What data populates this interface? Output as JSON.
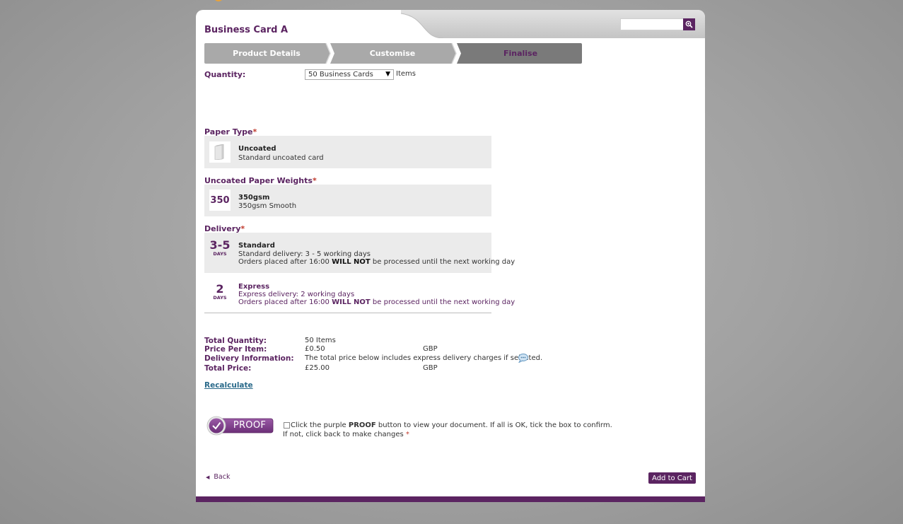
{
  "header": {
    "title": "Business Card A",
    "search": {
      "placeholder": "",
      "value": ""
    }
  },
  "steps": [
    {
      "label": "Product Details",
      "state": "done"
    },
    {
      "label": "Customise",
      "state": "done"
    },
    {
      "label": "Finalise",
      "state": "current"
    }
  ],
  "quantity": {
    "label": "Quantity:",
    "selected": "50 Business Cards",
    "unit": "Items"
  },
  "paper_type": {
    "label": "Paper Type",
    "required_mark": "*",
    "option": {
      "title": "Uncoated",
      "desc": "Standard uncoated card",
      "icon": "paper-icon"
    }
  },
  "paper_weight": {
    "label": "Uncoated Paper Weights",
    "required_mark": "*",
    "option": {
      "icon_text": "350",
      "title": "350gsm",
      "desc": "350gsm Smooth"
    }
  },
  "delivery": {
    "label": "Delivery",
    "required_mark": "*",
    "options": [
      {
        "icon_num": "3-5",
        "icon_unit": "DAYS",
        "title": "Standard",
        "desc": "Standard delivery: 3 - 5 working days",
        "note_before": "Orders placed after 16:00 ",
        "note_bold": "WILL NOT",
        "note_after": " be processed until the next working day",
        "selected": true
      },
      {
        "icon_num": "2",
        "icon_unit": "DAYS",
        "title": "Express",
        "desc": "Express delivery: 2 working days",
        "note_before": "Orders placed after 16:00 ",
        "note_bold": "WILL NOT",
        "note_after": " be processed until the next working day",
        "selected": false
      }
    ]
  },
  "summary": {
    "total_quantity_label": "Total Quantity:",
    "total_quantity_value": "50 Items",
    "price_per_item_label": "Price Per Item:",
    "price_per_item_value": "£0.50",
    "price_per_item_currency": "GBP",
    "delivery_info_label": "Delivery Information:",
    "delivery_info_value": "The total price below includes express delivery charges if selected.",
    "total_price_label": "Total Price:",
    "total_price_value": "£25.00",
    "total_price_currency": "GBP"
  },
  "recalculate_label": "Recalculate",
  "proof": {
    "button_label": "PROOF",
    "text_before": "Click the purple ",
    "text_bold": "PROOF",
    "text_after": " button to view your document. If all is OK, tick the box to confirm.",
    "text_line2": "If not, click back to make changes",
    "required_mark": "*",
    "checked": false
  },
  "footer": {
    "back_label": "Back",
    "add_to_cart_label": "Add to Cart"
  },
  "colors": {
    "brand": "#5b2461",
    "step_done": "#a9a9a9",
    "step_current": "#7a7a7a",
    "link": "#2a6a8a",
    "required": "#c0392b"
  }
}
